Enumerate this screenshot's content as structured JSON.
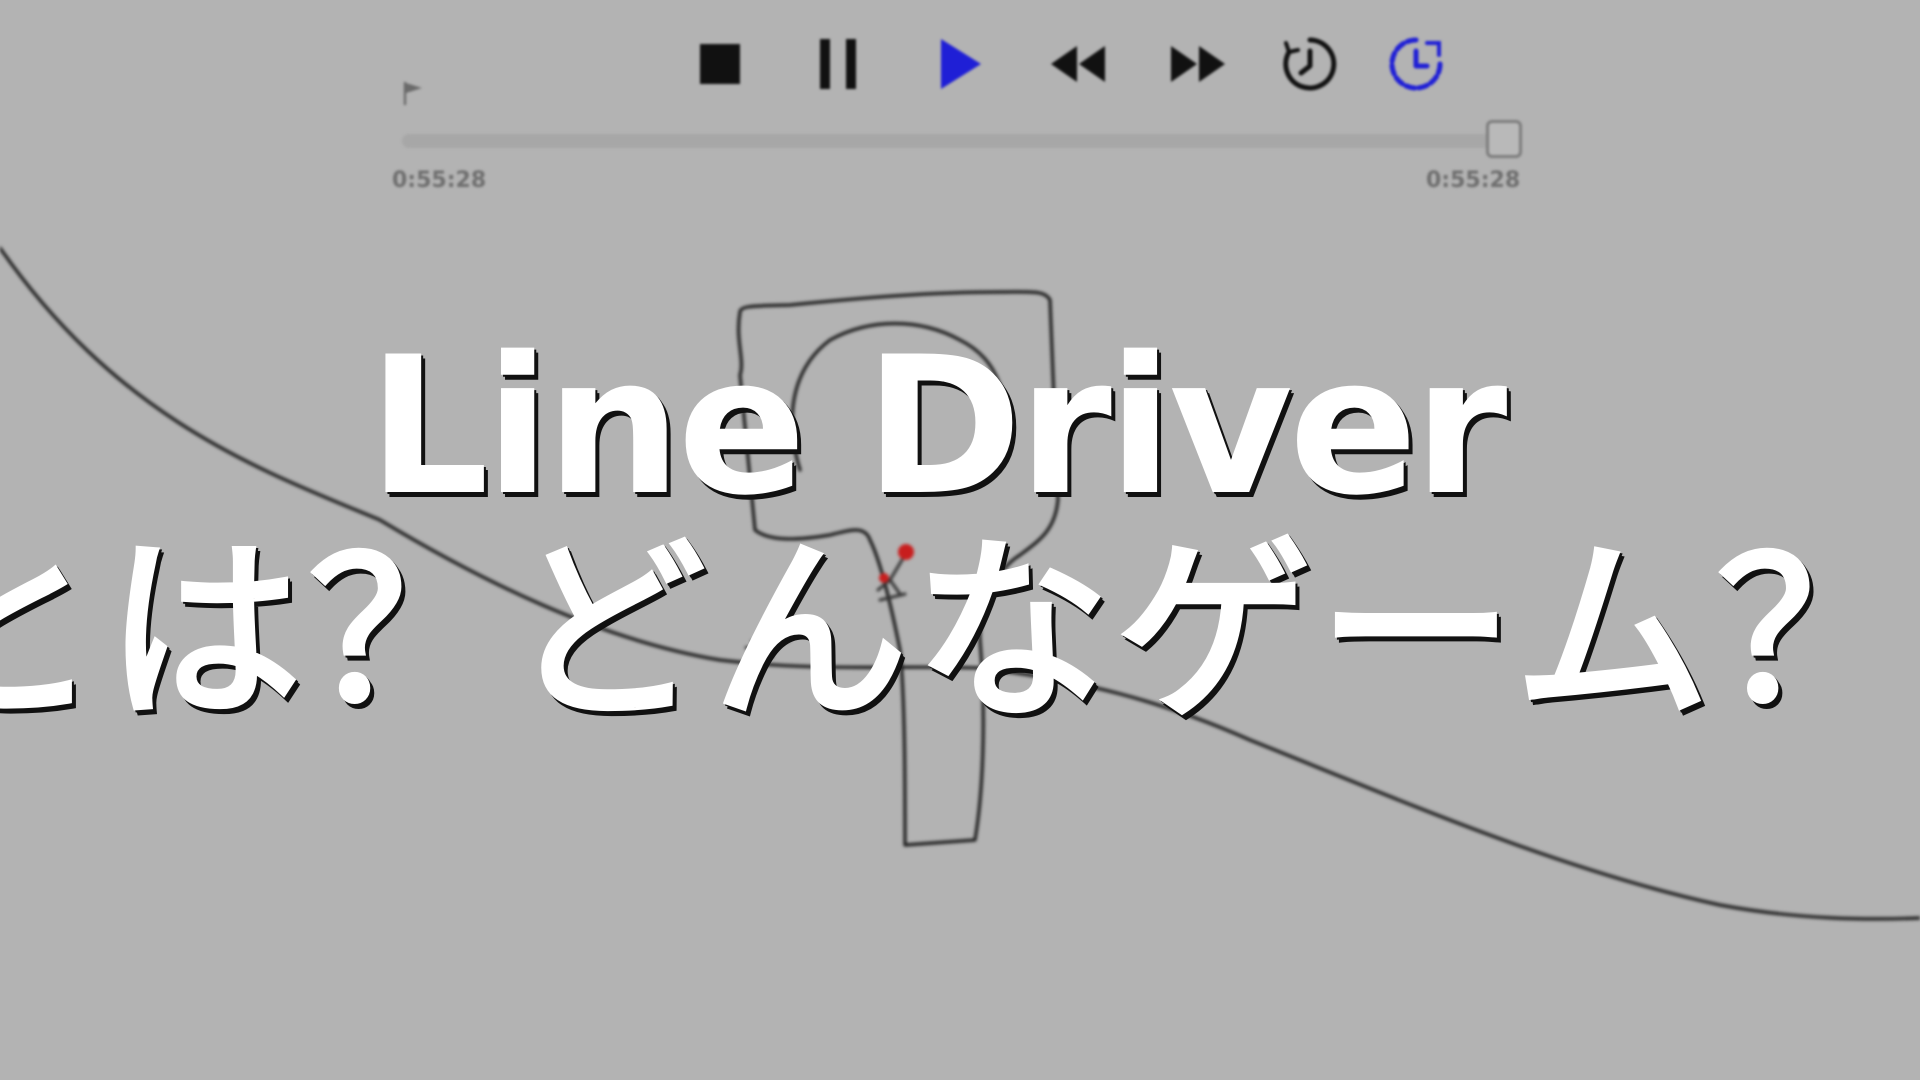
{
  "toolbar": {
    "buttons": [
      {
        "name": "stop-button",
        "icon": "stop-icon"
      },
      {
        "name": "pause-button",
        "icon": "pause-icon"
      },
      {
        "name": "play-button",
        "icon": "play-icon",
        "active": true
      },
      {
        "name": "rewind-button",
        "icon": "rewind-icon"
      },
      {
        "name": "fast-forward-button",
        "icon": "fast-forward-icon"
      },
      {
        "name": "slow-motion-button",
        "icon": "clock-icon"
      },
      {
        "name": "timer-button",
        "icon": "timer-icon",
        "active": true
      }
    ],
    "accent_color": "#1f1fd6",
    "icon_color": "#111111"
  },
  "timeline": {
    "start_time": "0:55:28",
    "end_time": "0:55:28",
    "flag_icon": "flag-icon",
    "progress": 1.0
  },
  "overlay_title": {
    "line1": "Line Driver",
    "line2": "とは？どんなゲーム？"
  },
  "colors": {
    "background": "#b3b3b3",
    "line": "#1a1a1a",
    "rider": "#c81e1e",
    "title_text": "#ffffff",
    "title_shadow": "#111111"
  }
}
